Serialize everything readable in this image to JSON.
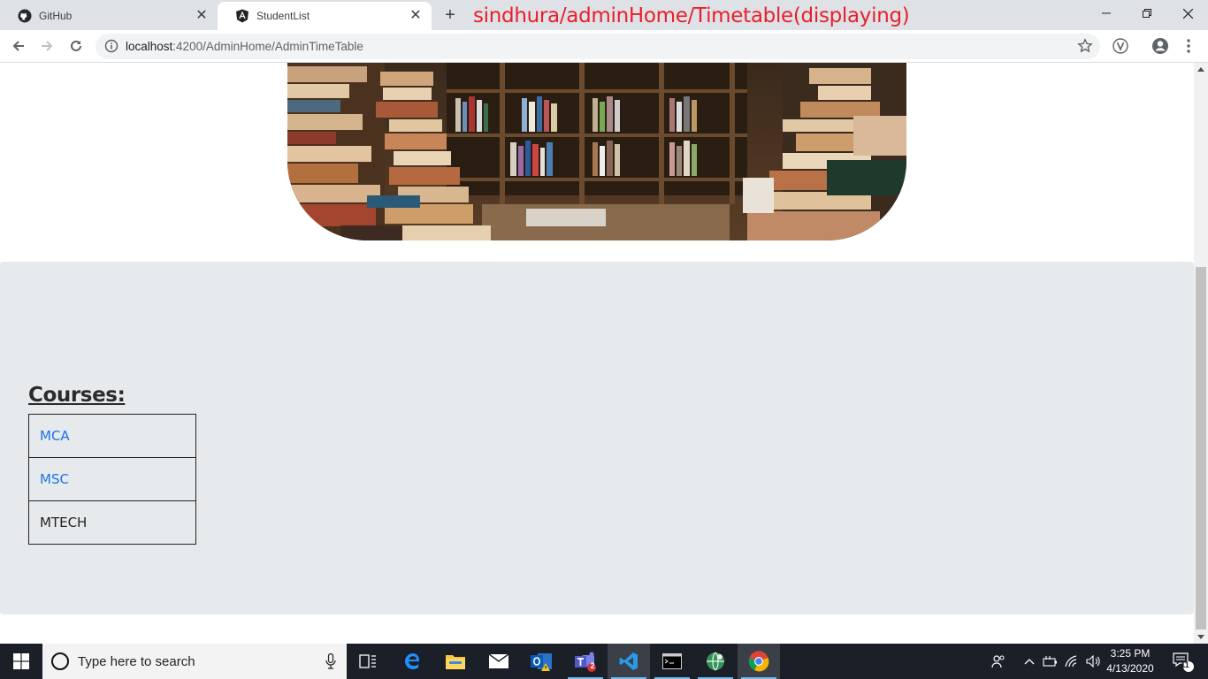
{
  "browser": {
    "tabs": [
      {
        "title": "GitHub",
        "icon": "github-icon",
        "active": false
      },
      {
        "title": "StudentList",
        "icon": "angular-icon",
        "active": true
      }
    ],
    "annotation": "sindhura/adminHome/Timetable(displaying)",
    "url_host": "localhost",
    "url_path": ":4200/AdminHome/AdminTimeTable",
    "window_controls": [
      "minimize",
      "restore",
      "close"
    ]
  },
  "page": {
    "courses_heading": "Courses:",
    "courses": [
      {
        "label": "MCA",
        "link": true
      },
      {
        "label": "MSC",
        "link": true
      },
      {
        "label": "MTECH",
        "link": false
      }
    ]
  },
  "taskbar": {
    "search_placeholder": "Type here to search",
    "time": "3:25 PM",
    "date": "4/13/2020",
    "apps": [
      "task-view",
      "edge",
      "file-explorer",
      "mail",
      "outlook",
      "teams",
      "vscode",
      "terminal",
      "network-app",
      "chrome"
    ],
    "teams_badge": "2",
    "notification_count": "11"
  },
  "colors": {
    "accent_link": "#1a73e8",
    "annotation": "#e8202a",
    "panel_bg": "#e7eaed",
    "taskbar_bg": "#1b1f27"
  }
}
